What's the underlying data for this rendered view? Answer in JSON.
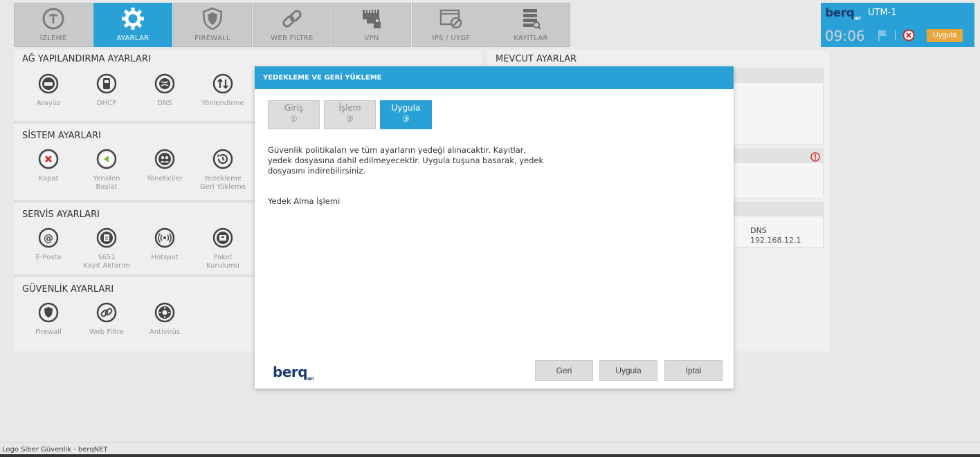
{
  "nav": {
    "tabs": [
      {
        "label": "İZLEME",
        "icon": "gauge-icon",
        "active": false
      },
      {
        "label": "AYARLAR",
        "icon": "gear-icon",
        "active": true
      },
      {
        "label": "FIREWALL",
        "icon": "shield-icon",
        "active": false
      },
      {
        "label": "WEB FİLTRE",
        "icon": "chain-link-icon",
        "active": false
      },
      {
        "label": "VPN",
        "icon": "network-port-lock-icon",
        "active": false
      },
      {
        "label": "IPS / UYGF",
        "icon": "window-blocked-icon",
        "active": false
      },
      {
        "label": "KAYITLAR",
        "icon": "database-search-icon",
        "active": false
      }
    ]
  },
  "header": {
    "brand": "berq",
    "brand_suffix": "NET",
    "device_name": "UTM-1",
    "time": "09:06",
    "apply_label": "Uygula",
    "accent_color": "#2aa1d6",
    "apply_color": "#e8a73b"
  },
  "settings": {
    "network": {
      "title": "AĞ YAPILANDIRMA AYARLARI",
      "items": [
        {
          "label": "Arayüz",
          "icon": "network-interface-icon"
        },
        {
          "label": "DHCP",
          "icon": "dhcp-server-icon"
        },
        {
          "label": "DNS",
          "icon": "globe-icon"
        },
        {
          "label": "Yönlendirme",
          "icon": "routing-arrows-icon"
        }
      ]
    },
    "system": {
      "title": "SİSTEM AYARLARI",
      "items": [
        {
          "label": "Kapat",
          "label2": "",
          "icon": "close-circle-icon"
        },
        {
          "label": "Yeniden",
          "label2": "Başlat",
          "icon": "restart-icon"
        },
        {
          "label": "Yöneticiler",
          "label2": "",
          "icon": "users-icon"
        },
        {
          "label": "Yedekleme",
          "label2": "Geri Yükleme",
          "icon": "backup-restore-icon"
        }
      ]
    },
    "service": {
      "title": "SERVİS AYARLARI",
      "items": [
        {
          "label": "E-Posta",
          "label2": "",
          "icon": "at-sign-icon"
        },
        {
          "label": "5651",
          "label2": "Kayıt Aktarım",
          "icon": "log-transfer-icon"
        },
        {
          "label": "Hotspot",
          "label2": "",
          "icon": "wifi-hotspot-icon"
        },
        {
          "label": "Paket",
          "label2": "Kurulumu",
          "icon": "package-icon"
        }
      ]
    },
    "security": {
      "title": "GÜVENLİK AYARLARI",
      "items": [
        {
          "label": "Firewall",
          "icon": "shield-icon"
        },
        {
          "label": "Web Filtre",
          "icon": "chain-link-icon"
        },
        {
          "label": "Antivirüs",
          "icon": "virus-icon"
        }
      ]
    }
  },
  "current": {
    "title": "MEVCUT AYARLAR",
    "dns_label": "DNS",
    "dns_value": "192.168.12.1"
  },
  "modal": {
    "title": "YEDEKLEME VE GERİ YÜKLEME",
    "steps": [
      {
        "label": "Giriş",
        "num": "①",
        "active": false
      },
      {
        "label": "İşlem",
        "num": "②",
        "active": false
      },
      {
        "label": "Uygula",
        "num": "③",
        "active": true
      }
    ],
    "description": "Güvenlik politikaları ve tüm ayarların yedeği alınacaktır. Kayıtlar, yedek dosyasına dahil edilmeyecektir. Uygula tuşuna basarak, yedek dosyasını indirebilirsiniz.",
    "process_label": "Yedek Alma İşlemi",
    "logo": "berq",
    "logo_suffix": "NET",
    "buttons": {
      "back": "Geri",
      "apply": "Uygula",
      "cancel": "İptal"
    }
  },
  "footer": {
    "text": "Logo Siber Güvenlik - berqNET"
  }
}
